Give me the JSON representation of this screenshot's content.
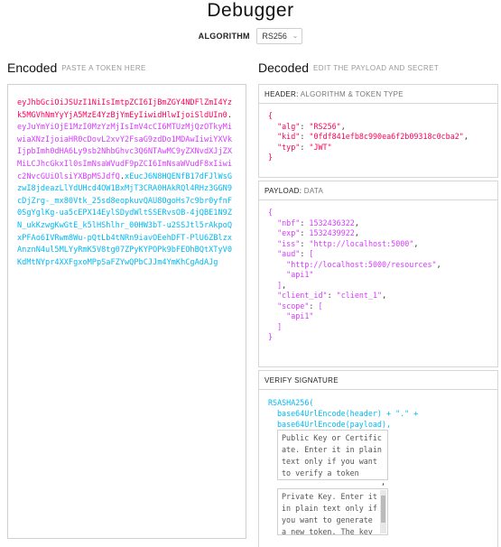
{
  "title": "Debugger",
  "algorithm": {
    "label": "ALGORITHM",
    "value": "RS256"
  },
  "encoded": {
    "title": "Encoded",
    "subtitle": "PASTE A TOKEN HERE",
    "header_part": "eyJhbGciOiJSUzI1NiIsImtpZCI6IjBmZGY4NDFlZmI4Yzk5MGVhNmYyYjA5MzE4YzBjYmEyIiwidHlwIjoiSldUIn0",
    "payload_part": "eyJuYmYiOjE1MzI0MzYzMjIsImV4cCI6MTUzMjQzOTkyMiwiaXNzIjoiaHR0cDovL2xvY2FsaG9zdDo1MDAwIiwiYXVkIjpbImh0dHA6Ly9sb2NhbGhvc3Q6NTAwMC9yZXNvdXJjZXMiLCJhcGkxIl0sImNsaWVudF9pZCI6ImNsaWVudF8xIiwic2NvcGUiOlsiYXBpMSJdfQ",
    "signature_part": "xEucJ6N8HQENfB17dFJlWsGzwI8jdeazLlYdUHcd4OW1BxMjT3CRA0HAkRQl4RHz3GGN9cDjZrg-_mx80Vtk_25sd8eopkuvQAU8OgoHs7c9br0yfnF0SgYglKg-ua5cEPX14EylSDydWltSSERvsOB-4jQBE1N9ZN_ukKzwgKwGtE_k5lHShlhr_00HW3bT-u2SSJtl5rAkpoQxPFAo6IVRwm8Wu-pQtLb4tNRn9iavOEehDFT-PlU6ZBlzxAnznN4ul5MLYyRmK5V8tg07ZPyKYPOPk9bFEOhBQtXTyV0KdMtNYpr4XXFgxoMPpSaFZYwQPbCJJm4YmKhCgAdAJg"
  },
  "decoded": {
    "title": "Decoded",
    "subtitle": "EDIT THE PAYLOAD AND SECRET",
    "header_panel": {
      "label": "HEADER:",
      "muted": "ALGORITHM & TOKEN TYPE",
      "alg_key": "\"alg\"",
      "alg_val": "\"RS256\"",
      "kid_key": "\"kid\"",
      "kid_val": "\"0fdf841efb8c990ea6f2b09318c0cba2\"",
      "typ_key": "\"typ\"",
      "typ_val": "\"JWT\""
    },
    "payload_panel": {
      "label": "PAYLOAD:",
      "muted": "DATA",
      "nbf_key": "\"nbf\"",
      "nbf_val": "1532436322",
      "exp_key": "\"exp\"",
      "exp_val": "1532439922",
      "iss_key": "\"iss\"",
      "iss_val": "\"http://localhost:5000\"",
      "aud_key": "\"aud\"",
      "aud_0": "\"http://localhost:5000/resources\"",
      "aud_1": "\"api1\"",
      "client_key": "\"client_id\"",
      "client_val": "\"client_1\"",
      "scope_key": "\"scope\"",
      "scope_0": "\"api1\""
    },
    "verify_panel": {
      "label": "VERIFY SIGNATURE",
      "fn": "RSASHA256(",
      "line1": "base64UrlEncode(header) + \".\" +",
      "line2": "base64UrlEncode(payload),",
      "public_key_placeholder": "Public Key or Certificate. Enter it in plain text only if you want to verify a token",
      "private_key_placeholder": "Private Key. Enter it in plain text only if you want to generate a new token. The key"
    }
  },
  "colors": {
    "header": "#fb015b",
    "payload": "#d63aff",
    "signature": "#00b9f1"
  }
}
